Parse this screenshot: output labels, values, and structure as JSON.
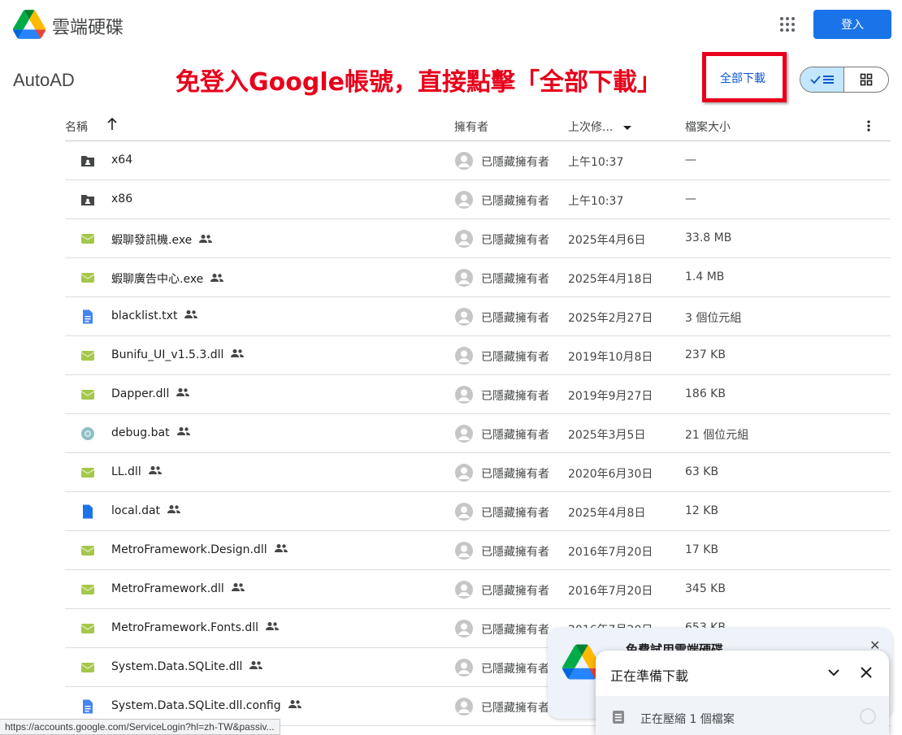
{
  "header": {
    "brand": "雲端硬碟",
    "apps_icon": "apps-grid-icon",
    "login_label": "登入"
  },
  "folder": {
    "title": "AutoAD",
    "download_all_label": "全部下載"
  },
  "annotation": {
    "text": "免登入Google帳號，直接點擊「全部下載」",
    "color": "#e8001b"
  },
  "view_toggle": {
    "list_icon": "check-list-icon",
    "grid_icon": "grid-view-icon",
    "active": "list"
  },
  "table": {
    "columns": {
      "name": "名稱",
      "owner": "擁有者",
      "modified": "上次修...",
      "size": "檔案大小"
    },
    "rows": [
      {
        "name": "x64",
        "icon": "shared-folder-icon",
        "owner": "已隱藏擁有者",
        "modified": "上午10:37",
        "size": "—",
        "shared": false
      },
      {
        "name": "x86",
        "icon": "shared-folder-icon",
        "owner": "已隱藏擁有者",
        "modified": "上午10:37",
        "size": "—",
        "shared": false
      },
      {
        "name": "蝦聊發訊機.exe",
        "icon": "binary-file-icon",
        "owner": "已隱藏擁有者",
        "modified": "2025年4月6日",
        "size": "33.8 MB",
        "shared": true
      },
      {
        "name": "蝦聊廣告中心.exe",
        "icon": "binary-file-icon",
        "owner": "已隱藏擁有者",
        "modified": "2025年4月18日",
        "size": "1.4 MB",
        "shared": true
      },
      {
        "name": "blacklist.txt",
        "icon": "text-doc-icon",
        "owner": "已隱藏擁有者",
        "modified": "2025年2月27日",
        "size": "3 個位元組",
        "shared": true
      },
      {
        "name": "Bunifu_UI_v1.5.3.dll",
        "icon": "binary-file-icon",
        "owner": "已隱藏擁有者",
        "modified": "2019年10月8日",
        "size": "237 KB",
        "shared": true
      },
      {
        "name": "Dapper.dll",
        "icon": "binary-file-icon",
        "owner": "已隱藏擁有者",
        "modified": "2019年9月27日",
        "size": "186 KB",
        "shared": true
      },
      {
        "name": "debug.bat",
        "icon": "script-file-icon",
        "owner": "已隱藏擁有者",
        "modified": "2025年3月5日",
        "size": "21 個位元組",
        "shared": true
      },
      {
        "name": "LL.dll",
        "icon": "binary-file-icon",
        "owner": "已隱藏擁有者",
        "modified": "2020年6月30日",
        "size": "63 KB",
        "shared": true
      },
      {
        "name": "local.dat",
        "icon": "data-file-icon",
        "owner": "已隱藏擁有者",
        "modified": "2025年4月8日",
        "size": "12 KB",
        "shared": true
      },
      {
        "name": "MetroFramework.Design.dll",
        "icon": "binary-file-icon",
        "owner": "已隱藏擁有者",
        "modified": "2016年7月20日",
        "size": "17 KB",
        "shared": true
      },
      {
        "name": "MetroFramework.dll",
        "icon": "binary-file-icon",
        "owner": "已隱藏擁有者",
        "modified": "2016年7月20日",
        "size": "345 KB",
        "shared": true
      },
      {
        "name": "MetroFramework.Fonts.dll",
        "icon": "binary-file-icon",
        "owner": "已隱藏擁有者",
        "modified": "2016年7月20日",
        "size": "653 KB",
        "shared": true
      },
      {
        "name": "System.Data.SQLite.dll",
        "icon": "binary-file-icon",
        "owner": "已隱藏擁有者",
        "modified": "",
        "size": "",
        "shared": true
      },
      {
        "name": "System.Data.SQLite.dll.config",
        "icon": "text-doc-icon",
        "owner": "已隱藏擁有者",
        "modified": "",
        "size": "",
        "shared": true
      }
    ]
  },
  "promo": {
    "title": "免費試用雲端硬碟"
  },
  "toast": {
    "title": "正在準備下載",
    "status": "正在壓縮 1 個檔案"
  },
  "statusbar": {
    "url": "https://accounts.google.com/ServiceLogin?hl=zh-TW&passiv..."
  },
  "colors": {
    "accent": "#1a73e8",
    "binary_icon": "#a3c84a",
    "doc_icon": "#4285f4",
    "selected_toggle": "#c2e7ff"
  }
}
